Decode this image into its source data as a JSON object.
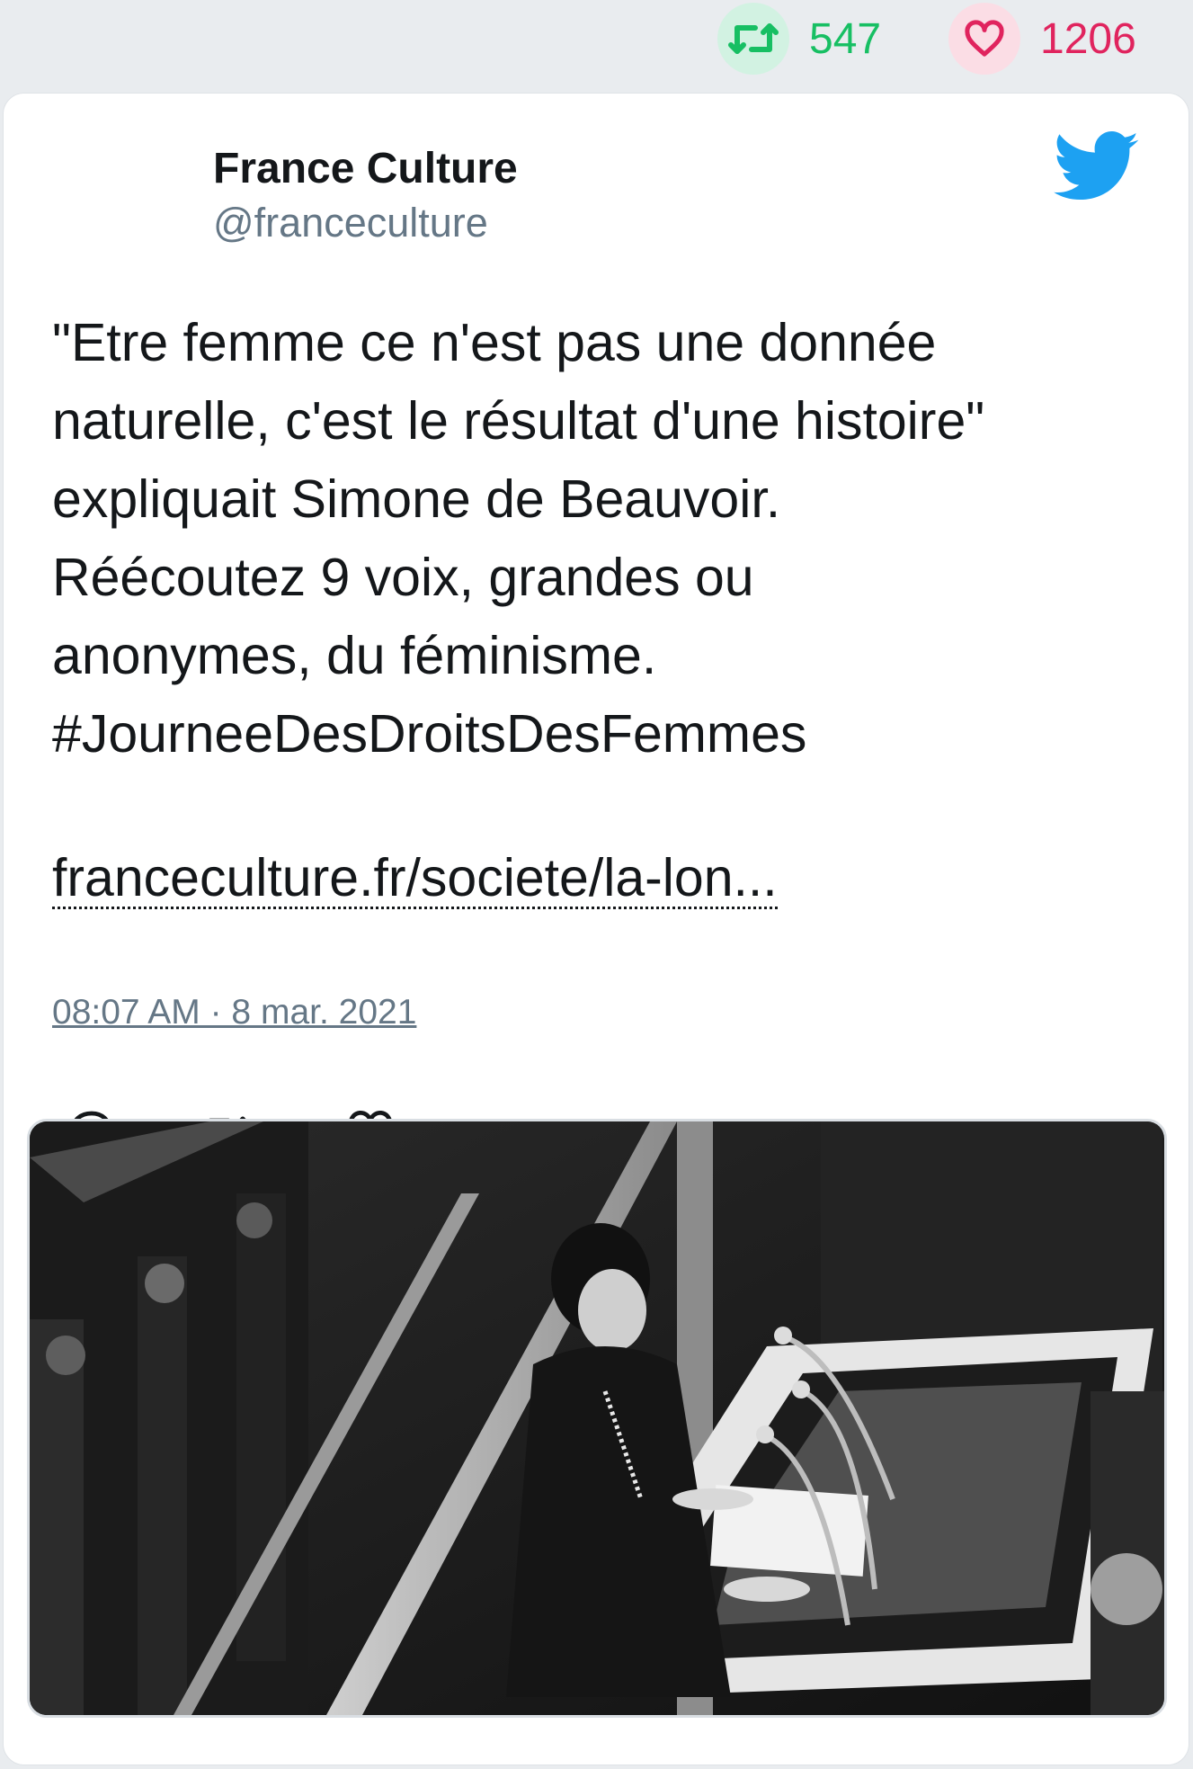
{
  "stats": {
    "retweets": "547",
    "likes": "1206",
    "retweet_color": "#17bf63",
    "like_color": "#e0245e"
  },
  "tweet": {
    "author_name": "France Culture",
    "author_handle": "@franceculture",
    "text": "\"Etre femme ce n'est pas une donnée\nnaturelle, c'est le résultat d'une histoire\"\nexpliquait Simone de Beauvoir.\nRééco utez 9 voix, grandes ou\nanonymes, du féminisme.\n#JourneeDesDroitsDesFemmes",
    "link": "franceculture.fr/societe/la-lon...",
    "timestamp": "08:07 AM · 8 mar. 2021"
  },
  "icons": {
    "retweet": "retweet-icon",
    "like": "heart-icon",
    "reply": "reply-icon",
    "brand": "twitter-bird-icon"
  },
  "media": {
    "type": "photo",
    "palette": "black-and-white"
  }
}
